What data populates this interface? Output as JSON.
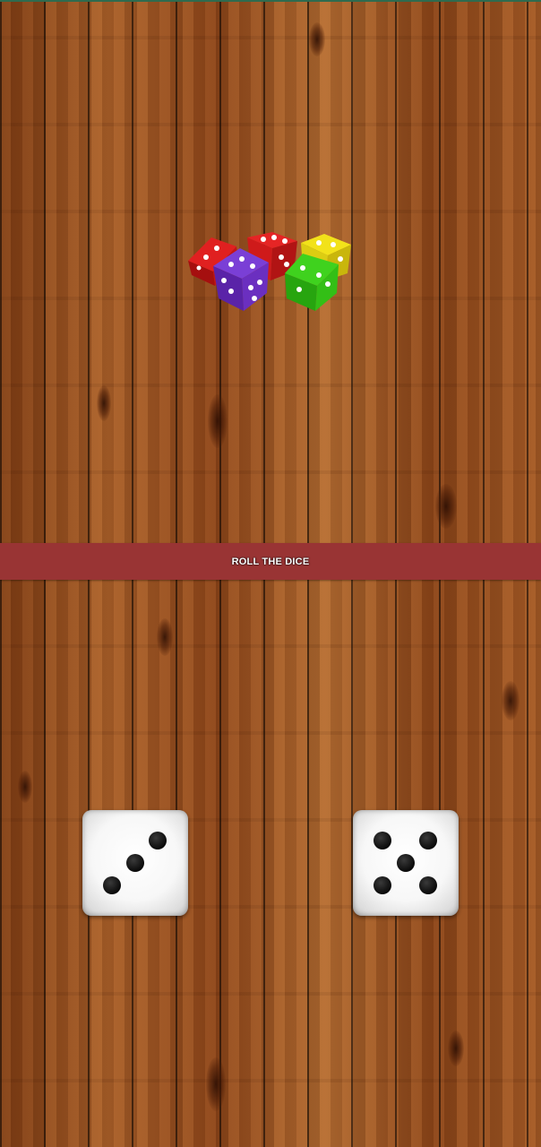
{
  "app": {
    "roll_button_label": "ROLL THE DICE"
  },
  "dice": {
    "left": {
      "face_value": 3
    },
    "right": {
      "face_value": 5
    }
  },
  "colors": {
    "banner": "#993434",
    "banner_text": "#ffffff",
    "wood": "#9a4f1f",
    "status_line": "#2f6b4f"
  },
  "icons": {
    "hero": "colored-dice-group-icon",
    "left_die": "die-face-3-icon",
    "right_die": "die-face-5-icon"
  }
}
